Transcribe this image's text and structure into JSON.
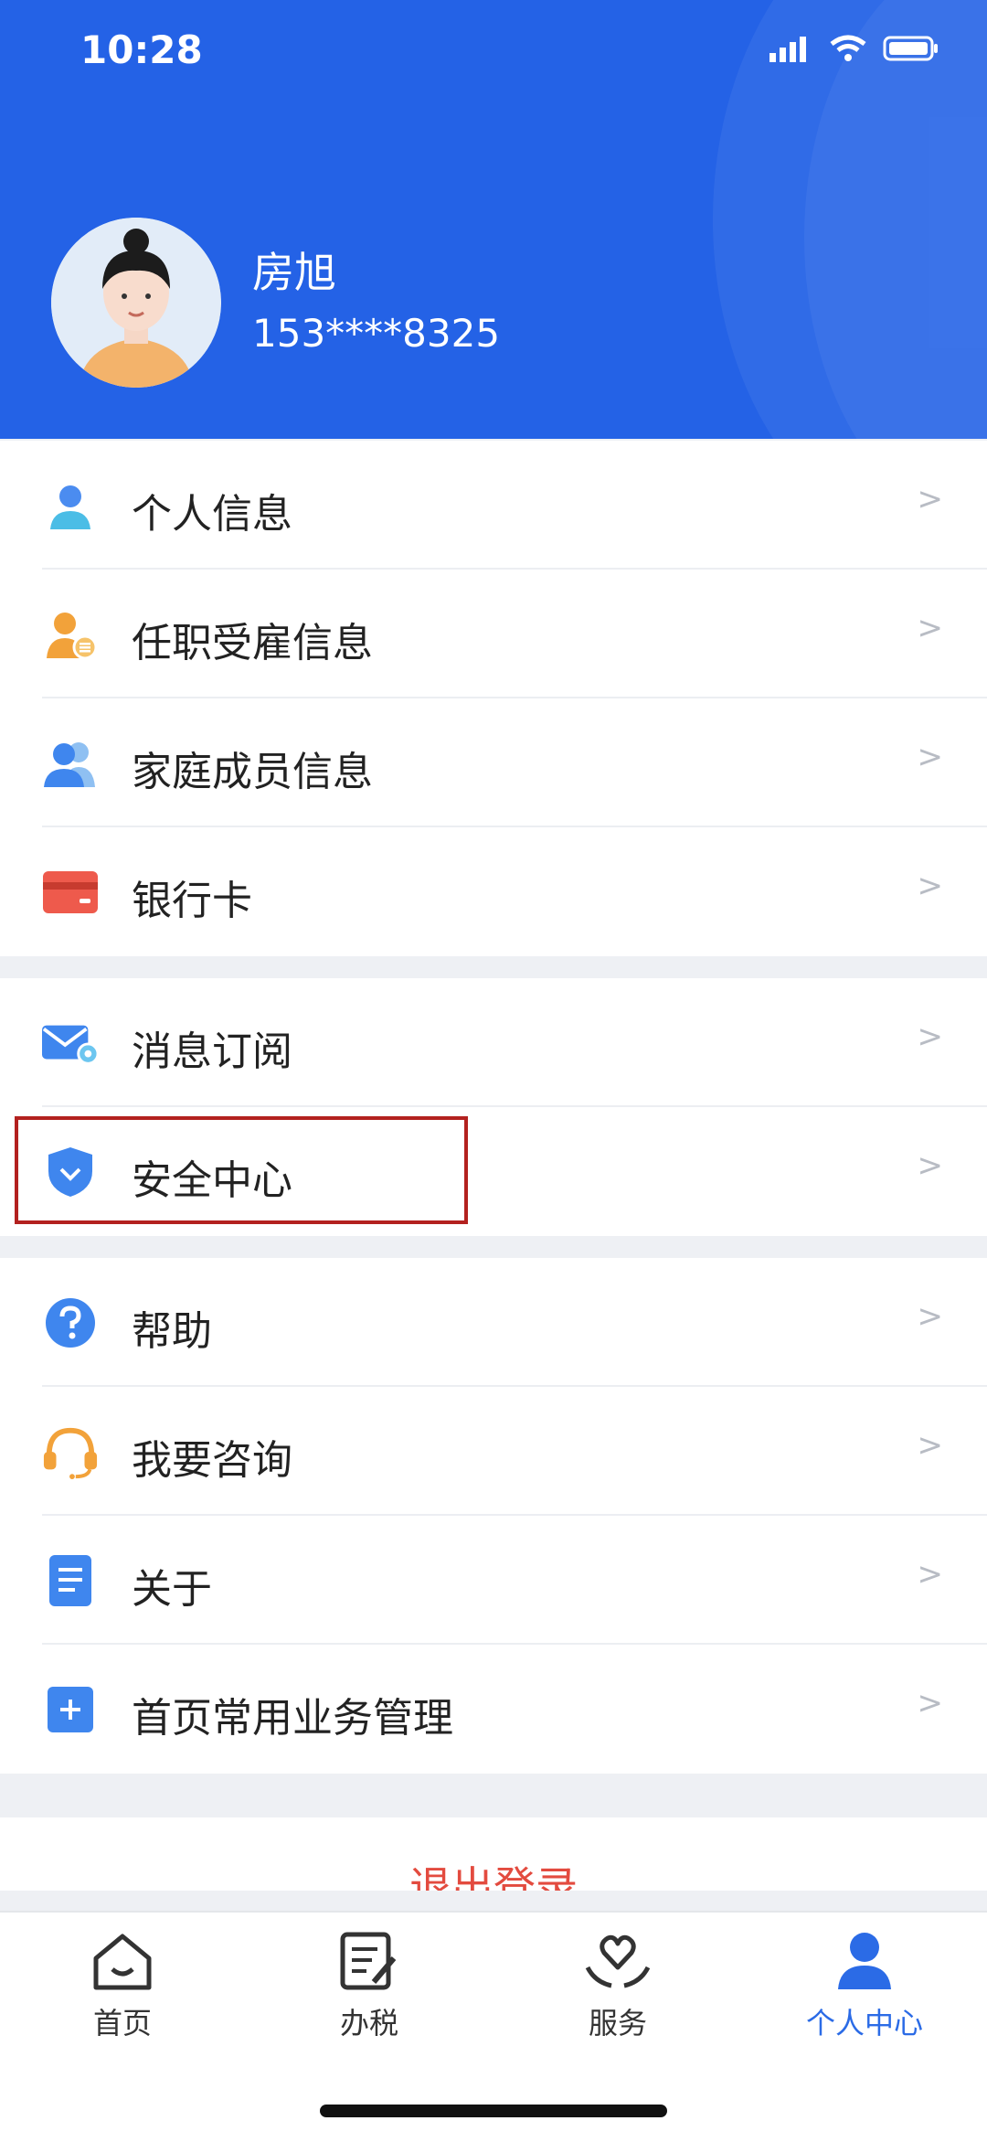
{
  "status_bar": {
    "time": "10:28"
  },
  "profile": {
    "name": "房旭",
    "phone": "153****8325"
  },
  "menu_groups": [
    [
      {
        "label": "个人信息",
        "icon": "person-icon"
      },
      {
        "label": "任职受雇信息",
        "icon": "employment-icon"
      },
      {
        "label": "家庭成员信息",
        "icon": "family-icon"
      },
      {
        "label": "银行卡",
        "icon": "bank-card-icon"
      }
    ],
    [
      {
        "label": "消息订阅",
        "icon": "mail-settings-icon"
      },
      {
        "label": "安全中心",
        "icon": "shield-icon"
      }
    ],
    [
      {
        "label": "帮助",
        "icon": "help-icon"
      },
      {
        "label": "我要咨询",
        "icon": "headset-icon"
      },
      {
        "label": "关于",
        "icon": "document-icon"
      },
      {
        "label": "首页常用业务管理",
        "icon": "plus-square-icon"
      }
    ]
  ],
  "chevron": ">",
  "logout_label": "退出登录",
  "tabbar": [
    {
      "label": "首页",
      "icon": "home-icon"
    },
    {
      "label": "办税",
      "icon": "tax-form-icon"
    },
    {
      "label": "服务",
      "icon": "service-heart-icon"
    },
    {
      "label": "个人中心",
      "icon": "profile-icon"
    }
  ],
  "colors": {
    "header_blue": "#2462e6",
    "accent": "#2b6be6",
    "highlight_border": "#b3211f",
    "logout_red": "#e34b3f"
  }
}
